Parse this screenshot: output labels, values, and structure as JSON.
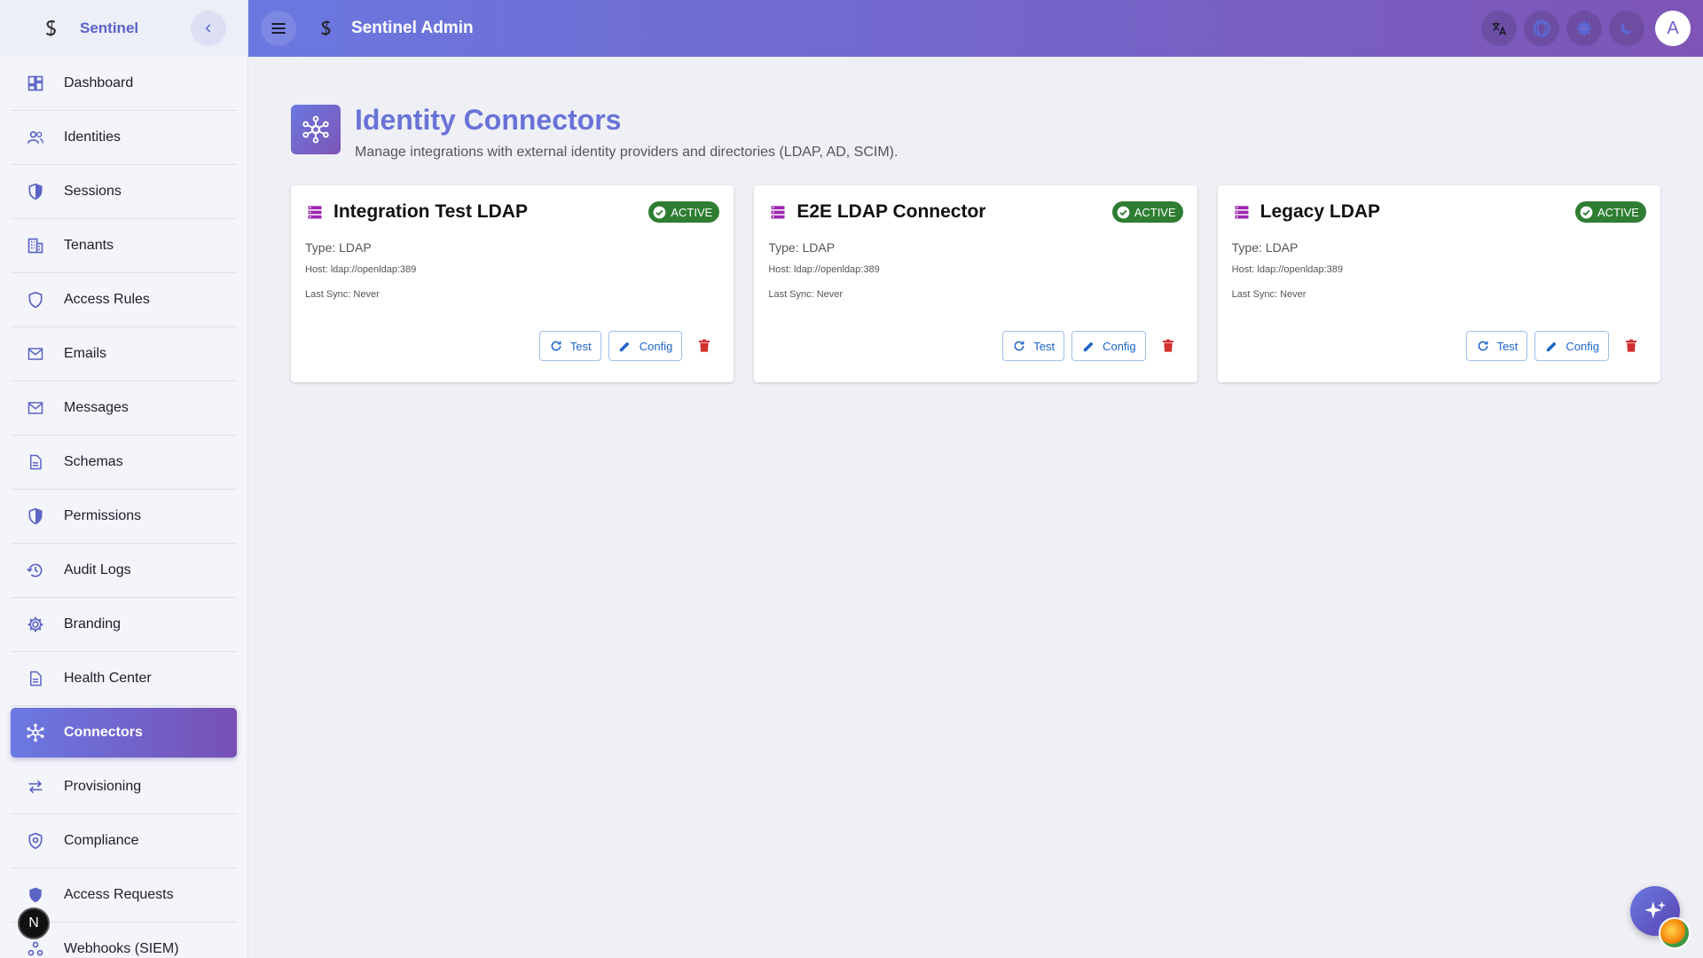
{
  "sidebar": {
    "brand": "Sentinel",
    "items": [
      {
        "label": "Dashboard",
        "icon": "dashboard-icon"
      },
      {
        "label": "Identities",
        "icon": "people-icon"
      },
      {
        "label": "Sessions",
        "icon": "shield-half-icon"
      },
      {
        "label": "Tenants",
        "icon": "building-icon"
      },
      {
        "label": "Access Rules",
        "icon": "shield-outline-icon"
      },
      {
        "label": "Emails",
        "icon": "mail-icon"
      },
      {
        "label": "Messages",
        "icon": "mail-icon"
      },
      {
        "label": "Schemas",
        "icon": "document-icon"
      },
      {
        "label": "Permissions",
        "icon": "shield-half-icon"
      },
      {
        "label": "Audit Logs",
        "icon": "history-icon"
      },
      {
        "label": "Branding",
        "icon": "gear-icon"
      },
      {
        "label": "Health Center",
        "icon": "document-icon"
      },
      {
        "label": "Connectors",
        "icon": "hub-icon",
        "active": true
      },
      {
        "label": "Provisioning",
        "icon": "swap-icon"
      },
      {
        "label": "Compliance",
        "icon": "shield-check-icon"
      },
      {
        "label": "Access Requests",
        "icon": "shield-lock-icon"
      },
      {
        "label": "Webhooks (SIEM)",
        "icon": "webhook-icon"
      }
    ]
  },
  "topbar": {
    "title": "Sentinel Admin",
    "avatar_letter": "A",
    "icons": [
      "translate-icon",
      "github-icon",
      "settings-icon",
      "dark-mode-icon"
    ]
  },
  "page": {
    "title": "Identity Connectors",
    "subtitle": "Manage integrations with external identity providers and directories (LDAP, AD, SCIM)."
  },
  "connectors": [
    {
      "name": "Integration Test LDAP",
      "status": "ACTIVE",
      "type": "Type: LDAP",
      "host": "Host: ldap://openldap:389",
      "last_sync": "Last Sync: Never",
      "test_label": "Test",
      "config_label": "Config"
    },
    {
      "name": "E2E LDAP Connector",
      "status": "ACTIVE",
      "type": "Type: LDAP",
      "host": "Host: ldap://openldap:389",
      "last_sync": "Last Sync: Never",
      "test_label": "Test",
      "config_label": "Config"
    },
    {
      "name": "Legacy LDAP",
      "status": "ACTIVE",
      "type": "Type: LDAP",
      "host": "Host: ldap://openldap:389",
      "last_sync": "Last Sync: Never",
      "test_label": "Test",
      "config_label": "Config"
    }
  ],
  "floating": {
    "n_badge": "N"
  },
  "colors": {
    "accent": "#6a72d8",
    "gradient_start": "#6a78e0",
    "gradient_end": "#7e55b6",
    "active_badge": "#2e7d32",
    "delete": "#d32f2f",
    "button_text": "#1e64c8"
  }
}
